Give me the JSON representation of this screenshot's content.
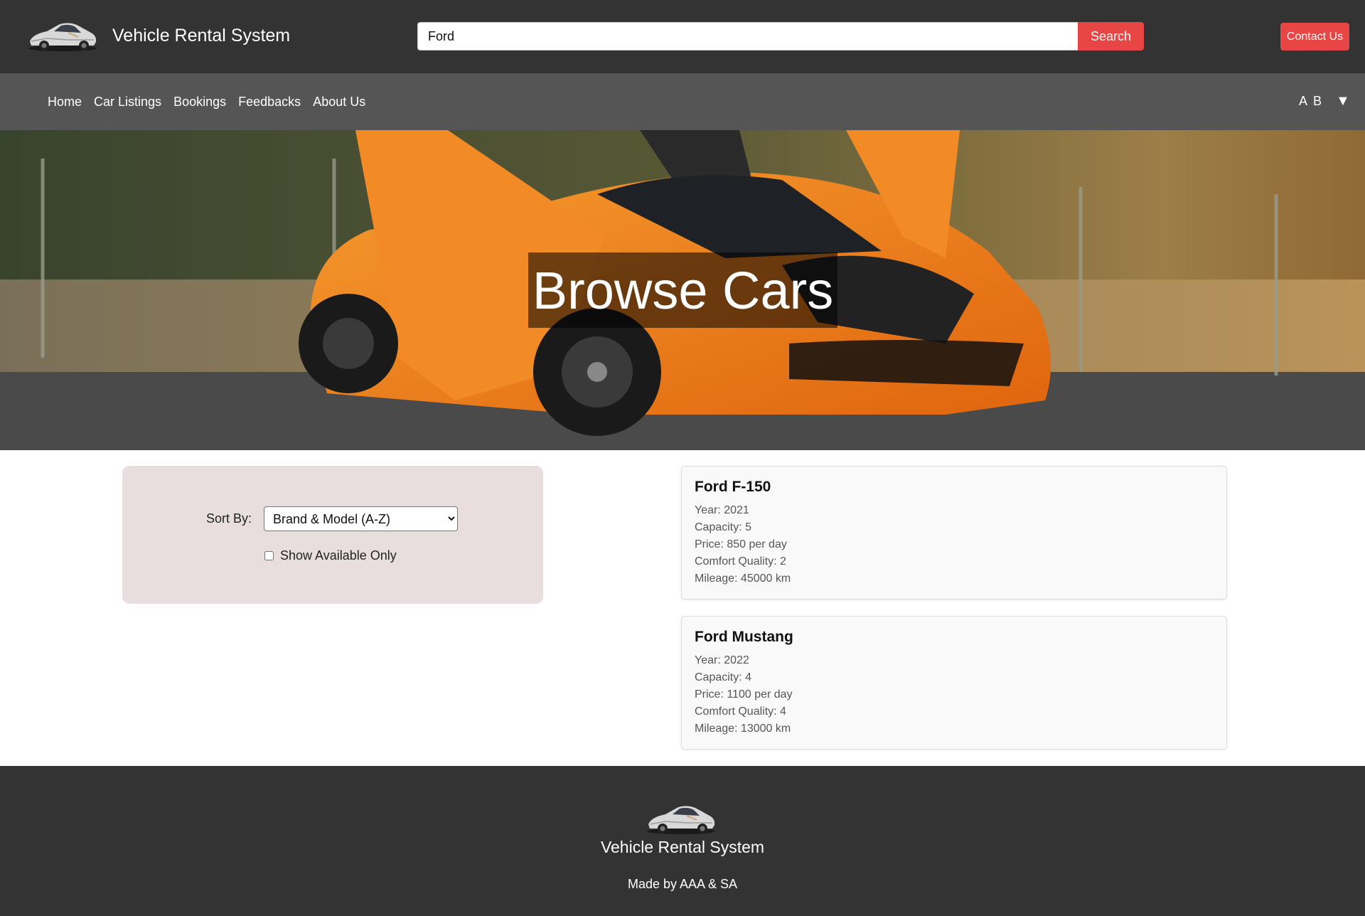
{
  "header": {
    "brand_title": "Vehicle Rental System",
    "search_value": "Ford",
    "search_button": "Search",
    "contact_button": "Contact Us"
  },
  "nav": {
    "links": [
      "Home",
      "Car Listings",
      "Bookings",
      "Feedbacks",
      "About Us"
    ],
    "user_initials": "A B",
    "user_caret": "▼"
  },
  "hero": {
    "title": "Browse Cars"
  },
  "filters": {
    "sort_label": "Sort By:",
    "sort_selected": "Brand & Model (A-Z)",
    "available_label": "Show Available Only",
    "available_checked": false
  },
  "cars": [
    {
      "title": "Ford F-150",
      "year": "Year: 2021",
      "capacity": "Capacity: 5",
      "price": "Price: 850 per day",
      "comfort": "Comfort Quality: 2",
      "mileage": "Mileage: 45000 km"
    },
    {
      "title": "Ford Mustang",
      "year": "Year: 2022",
      "capacity": "Capacity: 4",
      "price": "Price: 1100 per day",
      "comfort": "Comfort Quality: 4",
      "mileage": "Mileage: 13000 km"
    }
  ],
  "footer": {
    "title": "Vehicle Rental System",
    "made_by": "Made by AAA & SA"
  },
  "colors": {
    "header_bg": "#333333",
    "nav_bg": "#555555",
    "accent_red": "#e84545",
    "filter_bg": "#e8dede",
    "card_bg": "#f9f9f9"
  },
  "icons": {
    "logo": "car-logo-icon",
    "caret": "caret-down-icon"
  }
}
